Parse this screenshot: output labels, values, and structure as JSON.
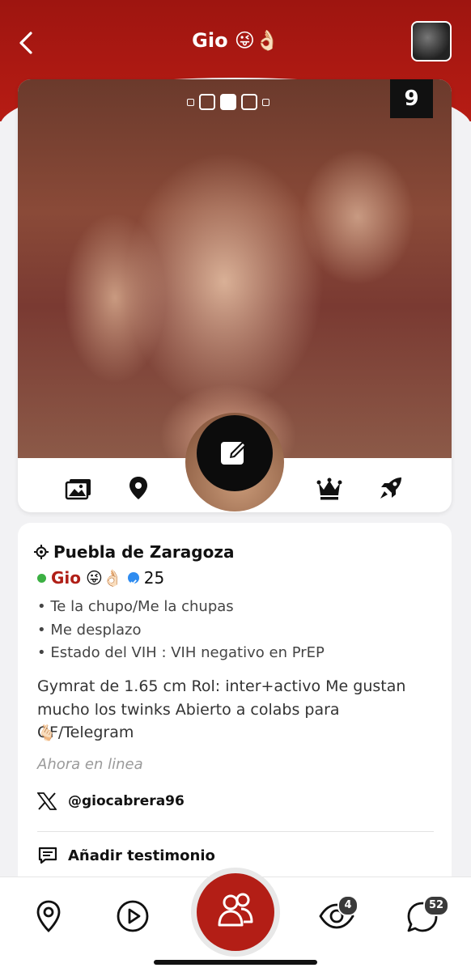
{
  "header": {
    "title": "Gio 😜👌🏻"
  },
  "gallery": {
    "photo_count": "9",
    "active_index": 2,
    "total_indicators": 5
  },
  "profile": {
    "location": "Puebla de Zaragoza",
    "name": "Gio",
    "name_emoji": "😜👌🏻",
    "age": "25",
    "online": true,
    "attributes": [
      "• Te la chupo/Me la chupas",
      "• Me desplazo",
      "• Estado del VIH : VIH negativo en PrEP"
    ],
    "bio": "Gymrat de 1.65 cm Rol: inter+activo Me gustan mucho los twinks Abierto a colabs para OF/Telegram",
    "bio_emoji": "🫰🏻",
    "last_seen": "Ahora en linea",
    "twitter": "@giocabrera96",
    "testimonial": "Añadir testimonio"
  },
  "tabbar": {
    "items": [
      {
        "icon": "map-pin-icon"
      },
      {
        "icon": "play-icon"
      },
      {
        "icon": "people-icon"
      },
      {
        "icon": "eye-icon",
        "badge": "4"
      },
      {
        "icon": "chat-icon",
        "badge": "52"
      }
    ]
  },
  "colors": {
    "brand": "#b31e16",
    "online": "#3cb043",
    "verified": "#2f8cf0"
  }
}
